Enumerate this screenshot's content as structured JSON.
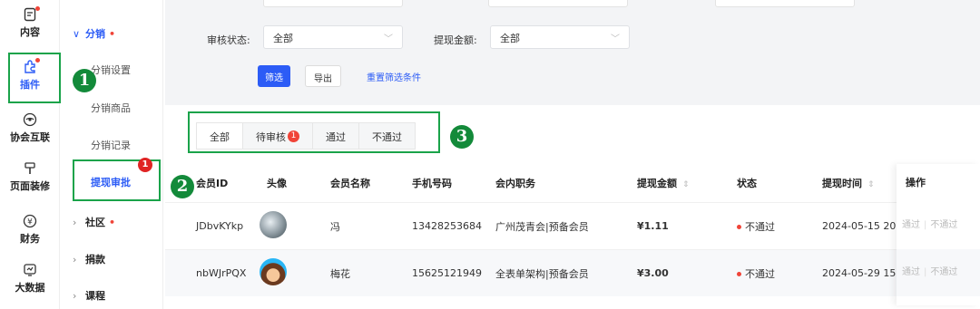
{
  "rail": [
    {
      "label": "内容",
      "icon": "document-icon",
      "dot": true
    },
    {
      "label": "插件",
      "icon": "plugin-icon",
      "dot": true,
      "active": true
    },
    {
      "label": "协会互联",
      "icon": "eye-icon"
    },
    {
      "label": "页面装修",
      "icon": "brush-icon"
    },
    {
      "label": "财务",
      "icon": "yuan-icon"
    },
    {
      "label": "大数据",
      "icon": "chart-icon"
    }
  ],
  "submenu": {
    "group1": "分销",
    "items": [
      "分销设置",
      "分销商品",
      "分销记录",
      "提现审批"
    ],
    "group2": "社区",
    "group3": "捐款",
    "group4": "课程"
  },
  "filters": {
    "audit_label": "审核状态:",
    "audit_value": "全部",
    "amount_label": "提现金额:",
    "amount_value": "全部",
    "filter_btn": "筛选",
    "export_btn": "导出",
    "reset_link": "重置筛选条件"
  },
  "tabs": [
    {
      "label": "全部"
    },
    {
      "label": "待审核",
      "badge": "1"
    },
    {
      "label": "通过"
    },
    {
      "label": "不通过"
    }
  ],
  "table": {
    "headers": [
      "会员ID",
      "头像",
      "会员名称",
      "手机号码",
      "会内职务",
      "提现金额",
      "状态",
      "提现时间",
      "操作"
    ],
    "rows": [
      {
        "id": "JDbvKYkp",
        "name": "冯",
        "phone": "13428253684",
        "role": "广州茂青会|预备会员",
        "amount": "¥1.11",
        "status": "不通过",
        "time": "2024-05-15 20:",
        "op_pass": "通过",
        "op_reject": "不通过"
      },
      {
        "id": "nbWJrPQX",
        "name": "梅花",
        "phone": "15625121949",
        "role": "全表单架构|预备会员",
        "amount": "¥3.00",
        "status": "不通过",
        "time": "2024-05-29 15:",
        "op_pass": "通过",
        "op_reject": "不通过"
      }
    ]
  },
  "annotations": [
    "1",
    "2",
    "3"
  ],
  "notif_badge": "1",
  "colors": {
    "accent": "#2c5cf6",
    "annotation": "#1aa34a",
    "danger": "#f04438"
  }
}
